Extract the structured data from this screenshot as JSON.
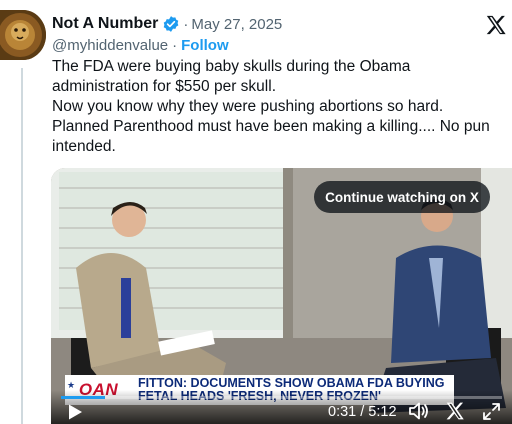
{
  "author": {
    "display_name": "Not A Number",
    "date_prefix": "·",
    "date": "May 27, 2025",
    "handle": "@myhiddenvalue",
    "handle_sep": "·",
    "follow_label": "Follow",
    "verified_icon": "verified-badge-icon"
  },
  "tweet": {
    "lines": [
      "The FDA were buying baby skulls during the Obama administration for $550 per skull.",
      "Now you know why they were pushing abortions so hard.",
      "Planned Parenthood must have been making a killing.... No pun intended."
    ]
  },
  "video": {
    "continue_label": "Continue watching on X",
    "channel_logo": "OAN",
    "headline": "FITTON: DOCUMENTS SHOW OBAMA FDA BUYING FETAL HEADS 'FRESH, NEVER FROZEN'",
    "time_display": "0:31 / 5:12",
    "progress_fraction": 0.1
  },
  "colors": {
    "accent": "#1d9bf0",
    "text": "#0f1419",
    "muted": "#536471",
    "headline_blue": "#0c2a78",
    "oan_red": "#c8102e"
  }
}
